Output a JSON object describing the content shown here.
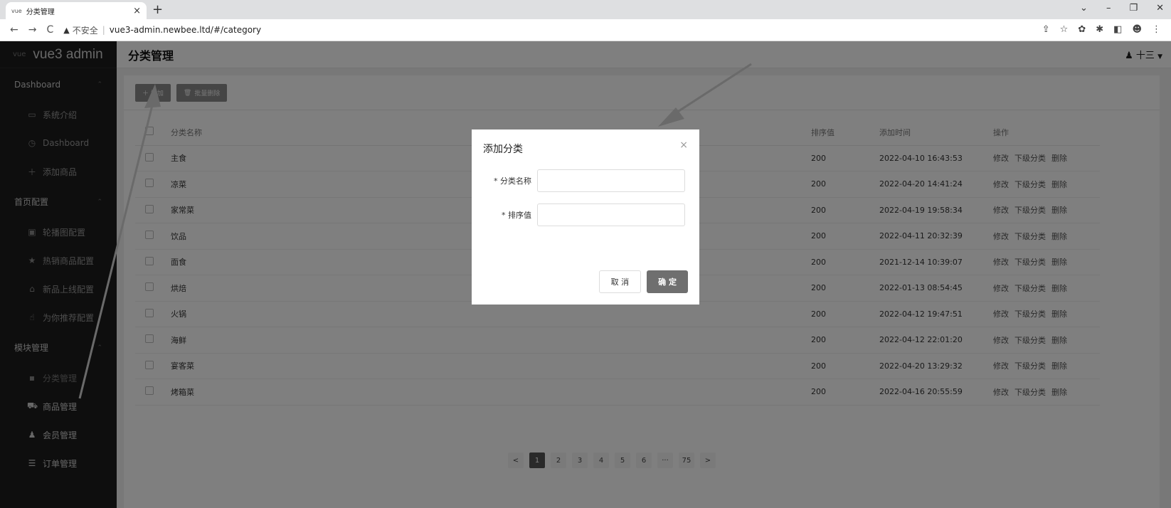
{
  "browser": {
    "tab_favicon": "vue",
    "tab_title": "分类管理",
    "tab_close": "×",
    "new_tab": "+",
    "security_text": "不安全",
    "url": "vue3-admin.newbee.ltd/#/category"
  },
  "sidebar": {
    "brand_logo": "vue",
    "brand_name": "vue3 admin",
    "groups": [
      {
        "label": "Dashboard",
        "items": [
          {
            "icon": "monitor-icon",
            "label": "系统介绍"
          },
          {
            "icon": "dashboard-icon",
            "label": "Dashboard"
          },
          {
            "icon": "plus-icon",
            "label": "添加商品"
          }
        ]
      },
      {
        "label": "首页配置",
        "items": [
          {
            "icon": "picture-icon",
            "label": "轮播图配置"
          },
          {
            "icon": "star-icon",
            "label": "热销商品配置"
          },
          {
            "icon": "sell-icon",
            "label": "新品上线配置"
          },
          {
            "icon": "thumb-icon",
            "label": "为你推荐配置"
          }
        ]
      },
      {
        "label": "模块管理",
        "items": [
          {
            "icon": "menu-grid-icon",
            "label": "分类管理"
          },
          {
            "icon": "bag-icon",
            "label": "商品管理"
          },
          {
            "icon": "user-icon",
            "label": "会员管理"
          },
          {
            "icon": "list-icon",
            "label": "订单管理"
          }
        ]
      }
    ]
  },
  "header": {
    "title": "分类管理",
    "user_name": "十三"
  },
  "toolbar": {
    "add_label": "＋ 增加",
    "batch_delete_label": "批量删除"
  },
  "table": {
    "columns": [
      "分类名称",
      "排序值",
      "添加时间",
      "操作"
    ],
    "rows": [
      {
        "name": "主食",
        "sort": "200",
        "time": "2022-04-10 16:43:53"
      },
      {
        "name": "凉菜",
        "sort": "200",
        "time": "2022-04-20 14:41:24"
      },
      {
        "name": "家常菜",
        "sort": "200",
        "time": "2022-04-19 19:58:34"
      },
      {
        "name": "饮品",
        "sort": "200",
        "time": "2022-04-11 20:32:39"
      },
      {
        "name": "面食",
        "sort": "200",
        "time": "2021-12-14 10:39:07"
      },
      {
        "name": "烘焙",
        "sort": "200",
        "time": "2022-01-13 08:54:45"
      },
      {
        "name": "火锅",
        "sort": "200",
        "time": "2022-04-12 19:47:51"
      },
      {
        "name": "海鲜",
        "sort": "200",
        "time": "2022-04-12 22:01:20"
      },
      {
        "name": "宴客菜",
        "sort": "200",
        "time": "2022-04-20 13:29:32"
      },
      {
        "name": "烤箱菜",
        "sort": "200",
        "time": "2022-04-16 20:55:59"
      }
    ],
    "row_actions": [
      "修改",
      "下级分类",
      "删除"
    ]
  },
  "pagination": {
    "prev": "<",
    "pages": [
      "1",
      "2",
      "3",
      "4",
      "5",
      "6",
      "···",
      "75"
    ],
    "current": "1",
    "next": ">"
  },
  "dialog": {
    "title": "添加分类",
    "close": "×",
    "name_label": "* 分类名称",
    "name_value": "",
    "sort_label": "* 排序值",
    "sort_value": "",
    "cancel_label": "取 消",
    "ok_label": "确 定"
  },
  "colors": {
    "sidebar_bg": "#1d1d1d",
    "primary_button": "#6f6f6f",
    "mask": "rgba(0,0,0,0.5)"
  }
}
